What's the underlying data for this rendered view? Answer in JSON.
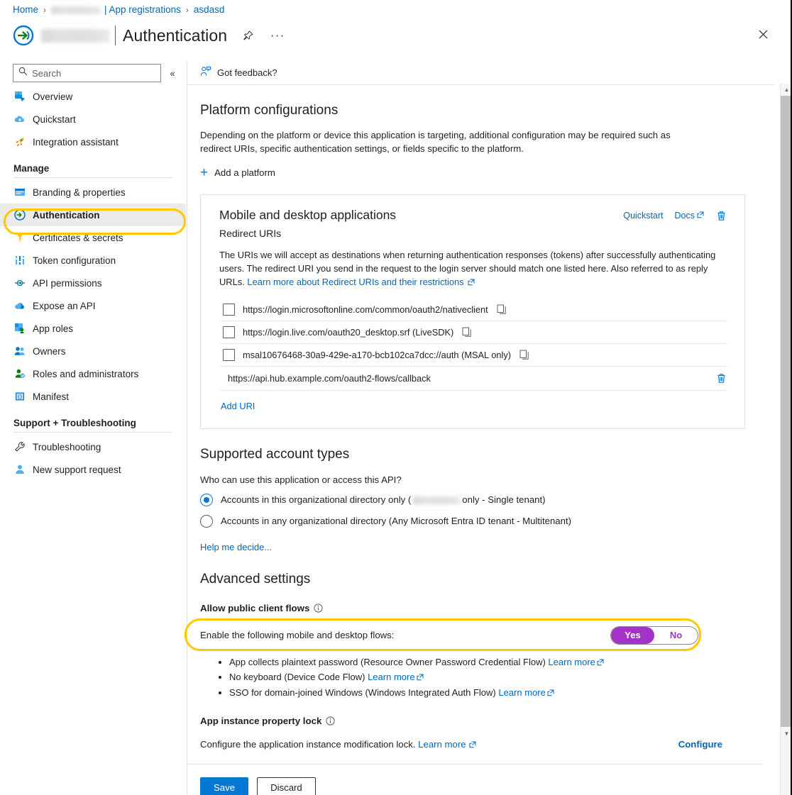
{
  "breadcrumb": {
    "home": "Home",
    "redacted_tenant": "",
    "app_registrations": "| App registrations",
    "current": "asdasd",
    "separator": "›"
  },
  "header": {
    "app_name_redacted": "",
    "title": "Authentication",
    "pin_icon": "pin-icon",
    "more_icon": "ellipsis-icon",
    "close_icon": "close-icon",
    "app_icon": "app-registration-icon"
  },
  "sidebar": {
    "search": {
      "placeholder": "Search",
      "value": "",
      "icon": "search-icon"
    },
    "collapse_icon": "«",
    "items": [
      {
        "label": "Overview",
        "icon": "overview-icon",
        "selected": false
      },
      {
        "label": "Quickstart",
        "icon": "quickstart-icon",
        "selected": false
      },
      {
        "label": "Integration assistant",
        "icon": "rocket-icon",
        "selected": false
      }
    ],
    "groups": [
      {
        "title": "Manage",
        "items": [
          {
            "label": "Branding & properties",
            "icon": "branding-icon",
            "selected": false
          },
          {
            "label": "Authentication",
            "icon": "authentication-icon",
            "selected": true
          },
          {
            "label": "Certificates & secrets",
            "icon": "key-icon",
            "selected": false
          },
          {
            "label": "Token configuration",
            "icon": "token-icon",
            "selected": false
          },
          {
            "label": "API permissions",
            "icon": "api-permissions-icon",
            "selected": false
          },
          {
            "label": "Expose an API",
            "icon": "cloud-icon",
            "selected": false
          },
          {
            "label": "App roles",
            "icon": "app-roles-icon",
            "selected": false
          },
          {
            "label": "Owners",
            "icon": "owners-icon",
            "selected": false
          },
          {
            "label": "Roles and administrators",
            "icon": "roles-admin-icon",
            "selected": false
          },
          {
            "label": "Manifest",
            "icon": "manifest-icon",
            "selected": false
          }
        ]
      },
      {
        "title": "Support + Troubleshooting",
        "items": [
          {
            "label": "Troubleshooting",
            "icon": "wrench-icon",
            "selected": false
          },
          {
            "label": "New support request",
            "icon": "support-person-icon",
            "selected": false
          }
        ]
      }
    ]
  },
  "commandbar": {
    "feedback_label": "Got feedback?",
    "feedback_icon": "feedback-person-icon"
  },
  "platform": {
    "heading": "Platform configurations",
    "description": "Depending on the platform or device this application is targeting, additional configuration may be required such as redirect URIs, specific authentication settings, or fields specific to the platform.",
    "add_platform_label": "Add a platform",
    "add_platform_icon": "plus-icon"
  },
  "card": {
    "title": "Mobile and desktop applications",
    "subtitle": "Redirect URIs",
    "quickstart_label": "Quickstart",
    "docs_label": "Docs",
    "delete_icon": "trash-icon",
    "external_icon": "external-link-icon",
    "description_prefix": "The URIs we will accept as destinations when returning authentication responses (tokens) after successfully authenticating users. The redirect URI you send in the request to the login server should match one listed here. Also referred to as reply URLs. ",
    "description_link": "Learn more about Redirect URIs and their restrictions",
    "uris": [
      {
        "value": "https://login.microsoftonline.com/common/oauth2/nativeclient",
        "checked": false,
        "type": "preset",
        "copy_icon": "copy-icon"
      },
      {
        "value": "https://login.live.com/oauth20_desktop.srf (LiveSDK)",
        "checked": false,
        "type": "preset",
        "copy_icon": "copy-icon"
      },
      {
        "value": "msal10676468-30a9-429e-a170-bcb102ca7dcc://auth (MSAL only)",
        "checked": false,
        "type": "preset",
        "copy_icon": "copy-icon"
      }
    ],
    "custom_uri": {
      "value": "https://api.hub.example.com/oauth2-flows/callback",
      "delete_icon": "trash-icon"
    },
    "add_uri_label": "Add URI"
  },
  "account_types": {
    "heading": "Supported account types",
    "question": "Who can use this application or access this API?",
    "options": [
      {
        "label_before": "Accounts in this organizational directory only (",
        "redacted": "",
        "label_after": "only - Single tenant)",
        "selected": true
      },
      {
        "label_before": "Accounts in any organizational directory (Any Microsoft Entra ID tenant - Multitenant)",
        "redacted": null,
        "label_after": "",
        "selected": false
      }
    ],
    "help_link": "Help me decide..."
  },
  "advanced": {
    "heading": "Advanced settings",
    "public_client": {
      "label": "Allow public client flows",
      "info_icon": "info-icon",
      "toggle_label": "Enable the following mobile and desktop flows:",
      "toggle": {
        "yes": "Yes",
        "no": "No",
        "value": "Yes",
        "accent": "#a333c8"
      },
      "flows": [
        {
          "text": "App collects plaintext password (Resource Owner Password Credential Flow) ",
          "link": "Learn more"
        },
        {
          "text": "No keyboard (Device Code Flow) ",
          "link": "Learn more"
        },
        {
          "text": "SSO for domain-joined Windows (Windows Integrated Auth Flow) ",
          "link": "Learn more"
        }
      ]
    },
    "property_lock": {
      "label": "App instance property lock",
      "info_icon": "info-icon",
      "description": "Configure the application instance modification lock. ",
      "link": "Learn more",
      "configure_label": "Configure"
    }
  },
  "footer": {
    "save_label": "Save",
    "discard_label": "Discard"
  },
  "annotations": {
    "highlight_color": "#ffc800",
    "rings": [
      "sidebar-item-authentication",
      "public-client-flows-toggle-row"
    ]
  },
  "scrollbar": {
    "up_icon": "▲",
    "down_icon": "▼"
  }
}
